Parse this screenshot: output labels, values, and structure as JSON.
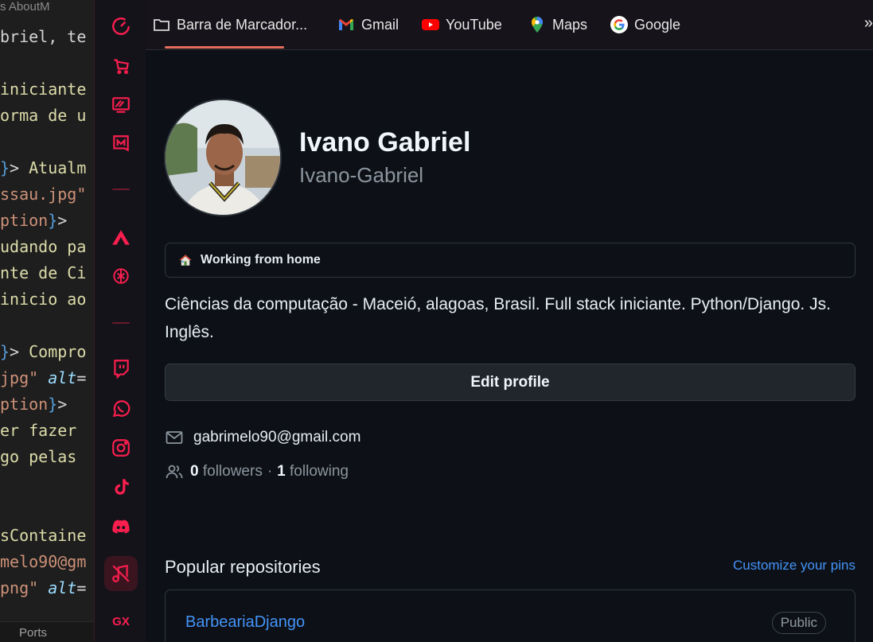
{
  "editor": {
    "tab_label": "s  AboutM",
    "lines": [
      {
        "segments": [
          {
            "c": "c-white",
            "t": "briel, te"
          }
        ]
      },
      {
        "segments": [
          {
            "c": "c-yellow",
            "t": "iniciante"
          }
        ]
      },
      {
        "segments": [
          {
            "c": "c-yellow",
            "t": "orma de u"
          }
        ]
      },
      {
        "segments": [
          {
            "c": "c-blue",
            "t": "}"
          },
          {
            "c": "c-white",
            "t": "> "
          },
          {
            "c": "c-yellow",
            "t": "Atualm"
          }
        ]
      },
      {
        "segments": [
          {
            "c": "c-orange",
            "t": "ssau.jpg\""
          }
        ]
      },
      {
        "segments": [
          {
            "c": "c-orange",
            "t": "ption"
          },
          {
            "c": "c-blue",
            "t": "}"
          },
          {
            "c": "c-white",
            "t": ">"
          }
        ]
      },
      {
        "segments": [
          {
            "c": "c-yellow",
            "t": "udando pa"
          }
        ]
      },
      {
        "segments": [
          {
            "c": "c-yellow",
            "t": "nte de Ci"
          }
        ]
      },
      {
        "segments": [
          {
            "c": "c-yellow",
            "t": "inicio ao"
          }
        ]
      },
      {
        "segments": [
          {
            "c": "c-blue",
            "t": "}"
          },
          {
            "c": "c-white",
            "t": "> "
          },
          {
            "c": "c-yellow",
            "t": "Compro"
          }
        ]
      },
      {
        "segments": [
          {
            "c": "c-orange",
            "t": "jpg\" "
          },
          {
            "c": "c-lblue",
            "t": "alt"
          },
          {
            "c": "c-white",
            "t": "="
          }
        ]
      },
      {
        "segments": [
          {
            "c": "c-orange",
            "t": "ption"
          },
          {
            "c": "c-blue",
            "t": "}"
          },
          {
            "c": "c-white",
            "t": ">"
          }
        ]
      },
      {
        "segments": [
          {
            "c": "c-yellow",
            "t": "er fazer"
          }
        ]
      },
      {
        "segments": [
          {
            "c": "c-yellow",
            "t": "go pelas"
          }
        ]
      },
      {
        "segments": [
          {
            "c": "c-yellow",
            "t": "sContaine"
          }
        ]
      },
      {
        "segments": [
          {
            "c": "c-orange",
            "t": "melo90@gm"
          }
        ]
      },
      {
        "segments": [
          {
            "c": "c-orange",
            "t": "png\" "
          },
          {
            "c": "c-lblue",
            "t": "alt"
          },
          {
            "c": "c-white",
            "t": "="
          }
        ]
      }
    ],
    "ports_label": "Ports"
  },
  "gx_sidebar": {
    "icons": [
      "speed-dial-icon",
      "shopping-icon",
      "gx-corner-icon",
      "gx-mods-icon",
      "divider",
      "aria-icon",
      "chatgpt-icon",
      "divider",
      "twitch-icon",
      "whatsapp-icon",
      "instagram-icon",
      "tiktok-icon",
      "discord-icon",
      "music-player-icon",
      "gx-logo-icon"
    ],
    "gx_text": "GX",
    "accent": "#fa1e4e"
  },
  "bookmarks": {
    "items": [
      {
        "label": "Barra de Marcador...",
        "icon": "folder-icon"
      },
      {
        "label": "Gmail",
        "icon": "gmail-icon"
      },
      {
        "label": "YouTube",
        "icon": "youtube-icon"
      },
      {
        "label": "Maps",
        "icon": "maps-icon"
      },
      {
        "label": "Google",
        "icon": "google-icon"
      }
    ],
    "more": "»"
  },
  "profile": {
    "name": "Ivano Gabriel",
    "login": "Ivano-Gabriel",
    "status_emoji": "house-icon",
    "status_text": "Working from home",
    "bio": "Ciências da computação - Maceió, alagoas, Brasil. Full stack iniciante. Python/Django. Js. Inglês.",
    "edit_button": "Edit profile",
    "email": "gabrimelo90@gmail.com",
    "followers_count": "0",
    "followers_label": "followers",
    "separator": "·",
    "following_count": "1",
    "following_label": "following"
  },
  "repositories": {
    "title": "Popular repositories",
    "customize_link": "Customize your pins",
    "items": [
      {
        "name": "BarbeariaDjango",
        "visibility": "Public"
      }
    ]
  },
  "colors": {
    "background": "#0d1117",
    "link": "#4493f8",
    "opera_accent": "#fa1e4e"
  }
}
